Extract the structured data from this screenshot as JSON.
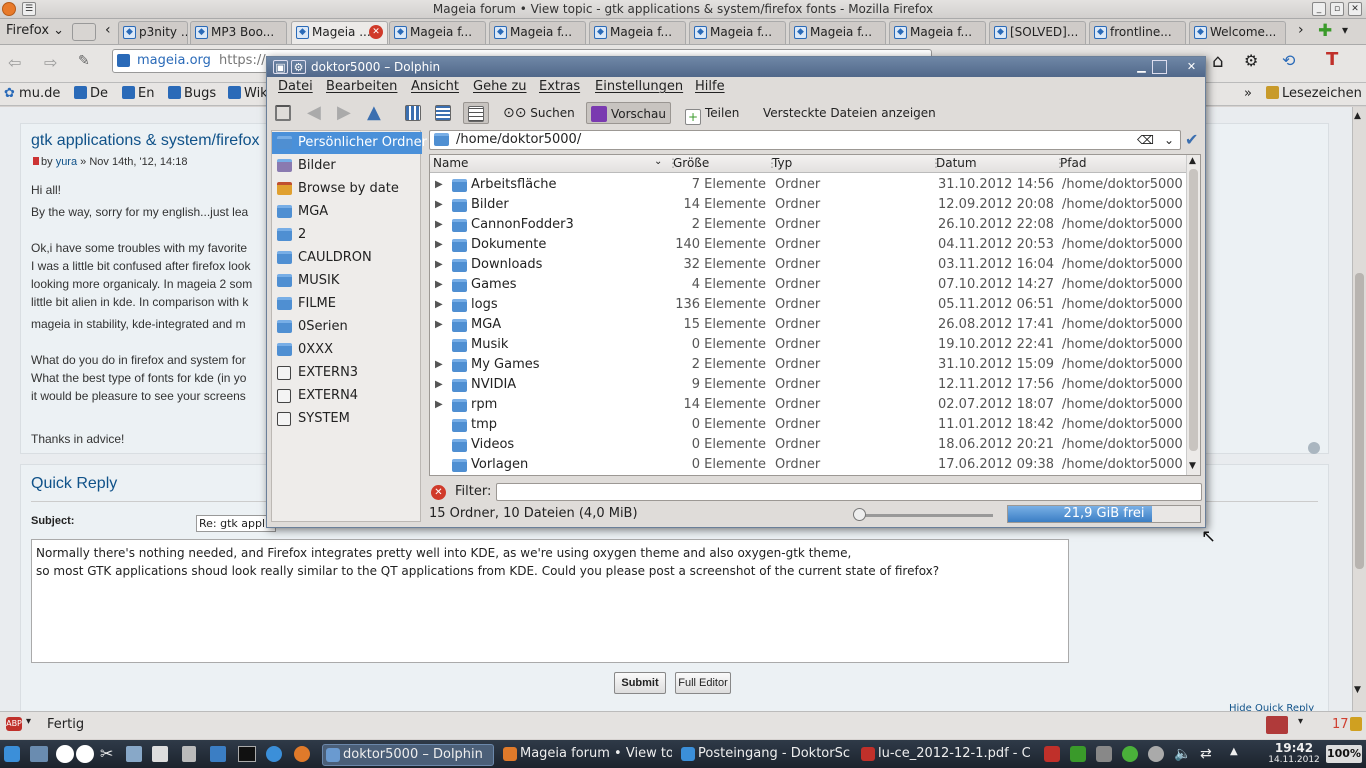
{
  "firefox": {
    "title": "Mageia forum • View topic - gtk applications & system/firefox fonts - Mozilla Firefox",
    "menu_label": "Firefox",
    "tabs": [
      "p3nity ...",
      "MP3 Boo...",
      "Mageia ...",
      "Mageia f...",
      "Mageia f...",
      "Mageia f...",
      "Mageia f...",
      "Mageia f...",
      "Mageia f...",
      "[SOLVED]...",
      "frontline...",
      "Welcome..."
    ],
    "url_site": "mageia.org",
    "url_text": "https://",
    "bookmarks": [
      "mu.de",
      "De",
      "En",
      "Bugs",
      "Wik"
    ],
    "bookmarks_right": "Lesezeichen",
    "status_text": "Fertig",
    "zoom": "100%",
    "status_count": "17"
  },
  "post": {
    "title": "gtk applications & system/firefox",
    "byline_prefix": "by ",
    "author": "yura",
    "date": "» Nov 14th, '12, 14:18",
    "lines": [
      "Hi all!",
      "By the way, sorry for my english...just lea",
      "Ok,i have some troubles with my favorite",
      "I was a little bit confused after firefox look",
      "looking more organicaly. In mageia 2 som",
      "little bit alien in kde. In comparison with k",
      "mageia in stability, kde-integrated and m",
      "What do you do in firefox and system for",
      "What the best type of fonts for kde (in yo",
      "it would be pleasure to see your screens",
      "Thanks in advice!"
    ]
  },
  "quick_reply": {
    "title": "Quick Reply",
    "subject_label": "Subject:",
    "subject_value": "Re: gtk applica",
    "message_line1": "Normally there's nothing needed, and Firefox integrates pretty well into KDE, as we're using oxygen theme and also oxygen-gtk theme,",
    "message_line2": "so most GTK applications shoud look really similar to the QT applications from KDE. Could you please post a screenshot of the current state of firefox?",
    "submit": "Submit",
    "full_editor": "Full Editor",
    "hide": "Hide Quick Reply"
  },
  "dolphin": {
    "title": "doktor5000 – Dolphin",
    "menu": [
      "Datei",
      "Bearbeiten",
      "Ansicht",
      "Gehe zu",
      "Extras",
      "Einstellungen",
      "Hilfe"
    ],
    "toolbar": {
      "search": "Suchen",
      "preview": "Vorschau",
      "share": "Teilen",
      "hidden": "Versteckte Dateien anzeigen"
    },
    "places": [
      {
        "label": "Persönlicher Ordner",
        "icon": "home-folder-icon",
        "selected": true
      },
      {
        "label": "Bilder",
        "icon": "pictures-folder-icon"
      },
      {
        "label": "Browse by date",
        "icon": "calendar-icon"
      },
      {
        "label": "MGA",
        "icon": "folder-icon"
      },
      {
        "label": "2",
        "icon": "folder-icon"
      },
      {
        "label": "CAULDRON",
        "icon": "folder-icon"
      },
      {
        "label": "MUSIK",
        "icon": "folder-icon"
      },
      {
        "label": "FILME",
        "icon": "folder-icon"
      },
      {
        "label": "0Serien",
        "icon": "folder-icon"
      },
      {
        "label": "0XXX",
        "icon": "folder-icon"
      },
      {
        "label": "EXTERN3",
        "icon": "drive-icon"
      },
      {
        "label": "EXTERN4",
        "icon": "drive-icon"
      },
      {
        "label": "SYSTEM",
        "icon": "drive-icon"
      }
    ],
    "location": "/home/doktor5000/",
    "columns": [
      "Name",
      "Größe",
      "Typ",
      "Datum",
      "Pfad"
    ],
    "rows": [
      {
        "name": "Arbeitsfläche",
        "size": "7 Elemente",
        "type": "Ordner",
        "date": "31.10.2012 14:56",
        "path": "/home/doktor5000",
        "expand": true
      },
      {
        "name": "Bilder",
        "size": "14 Elemente",
        "type": "Ordner",
        "date": "12.09.2012 20:08",
        "path": "/home/doktor5000",
        "expand": true
      },
      {
        "name": "CannonFodder3",
        "size": "2 Elemente",
        "type": "Ordner",
        "date": "26.10.2012 22:08",
        "path": "/home/doktor5000",
        "expand": true
      },
      {
        "name": "Dokumente",
        "size": "140 Elemente",
        "type": "Ordner",
        "date": "04.11.2012 20:53",
        "path": "/home/doktor5000",
        "expand": true
      },
      {
        "name": "Downloads",
        "size": "32 Elemente",
        "type": "Ordner",
        "date": "03.11.2012 16:04",
        "path": "/home/doktor5000",
        "expand": true
      },
      {
        "name": "Games",
        "size": "4 Elemente",
        "type": "Ordner",
        "date": "07.10.2012 14:27",
        "path": "/home/doktor5000",
        "expand": true
      },
      {
        "name": "logs",
        "size": "136 Elemente",
        "type": "Ordner",
        "date": "05.11.2012 06:51",
        "path": "/home/doktor5000",
        "expand": true
      },
      {
        "name": "MGA",
        "size": "15 Elemente",
        "type": "Ordner",
        "date": "26.08.2012 17:41",
        "path": "/home/doktor5000",
        "expand": true
      },
      {
        "name": "Musik",
        "size": "0 Elemente",
        "type": "Ordner",
        "date": "19.10.2012 22:41",
        "path": "/home/doktor5000",
        "expand": false
      },
      {
        "name": "My Games",
        "size": "2 Elemente",
        "type": "Ordner",
        "date": "31.10.2012 15:09",
        "path": "/home/doktor5000",
        "expand": true
      },
      {
        "name": "NVIDIA",
        "size": "9 Elemente",
        "type": "Ordner",
        "date": "12.11.2012 17:56",
        "path": "/home/doktor5000",
        "expand": true
      },
      {
        "name": "rpm",
        "size": "14 Elemente",
        "type": "Ordner",
        "date": "02.07.2012 18:07",
        "path": "/home/doktor5000",
        "expand": true
      },
      {
        "name": "tmp",
        "size": "0 Elemente",
        "type": "Ordner",
        "date": "11.01.2012 18:42",
        "path": "/home/doktor5000",
        "expand": false
      },
      {
        "name": "Videos",
        "size": "0 Elemente",
        "type": "Ordner",
        "date": "18.06.2012 20:21",
        "path": "/home/doktor5000",
        "expand": false
      },
      {
        "name": "Vorlagen",
        "size": "0 Elemente",
        "type": "Ordner",
        "date": "17.06.2012 09:38",
        "path": "/home/doktor5000",
        "expand": false
      }
    ],
    "filter_label": "Filter:",
    "status": "15 Ordner, 10 Dateien (4,0 MiB)",
    "free_space": "21,9 GiB frei",
    "disk_used_fraction": 0.75
  },
  "taskbar": {
    "tasks": [
      "doktor5000 – Dolphin",
      "Mageia forum • View to",
      "Posteingang - DoktorSc",
      "lu-ce_2012-12-1.pdf - C"
    ],
    "time": "19:42",
    "date": "14.11.2012"
  }
}
